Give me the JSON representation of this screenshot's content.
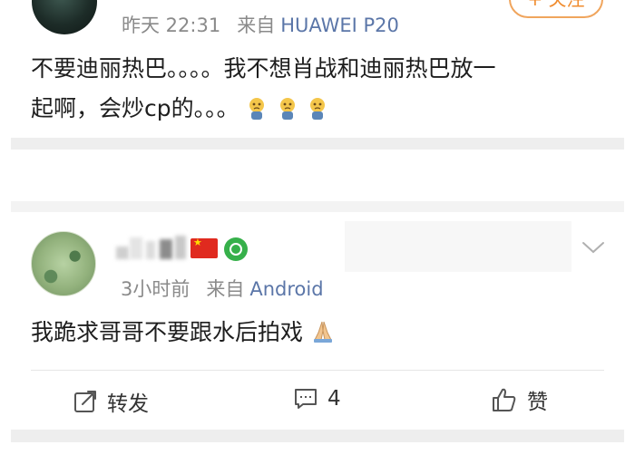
{
  "post": {
    "meta_time": "昨天 22:31",
    "meta_from_label": "来自",
    "meta_source": "HUAWEI P20",
    "follow_label": "+ 关注",
    "text_line1": "不要迪丽热巴。。。。我不想肖战和迪丽热巴放一",
    "text_line2": "起啊，会炒cp的。。。",
    "emoji": [
      "crying-face",
      "crying-face",
      "crying-face"
    ]
  },
  "comment": {
    "meta_time": "3小时前",
    "meta_from_label": "来自",
    "meta_source": "Android",
    "text": "我跪求哥哥不要跟水后拍戏",
    "emoji": "folded-hands"
  },
  "actions": {
    "repost_label": "转发",
    "comment_count": "4",
    "like_label": "赞"
  },
  "colors": {
    "link_blue": "#5b76a8",
    "follow_orange": "#f08b2d",
    "meta_grey": "#8a8a8a",
    "separator_band": "#eeeeee"
  }
}
